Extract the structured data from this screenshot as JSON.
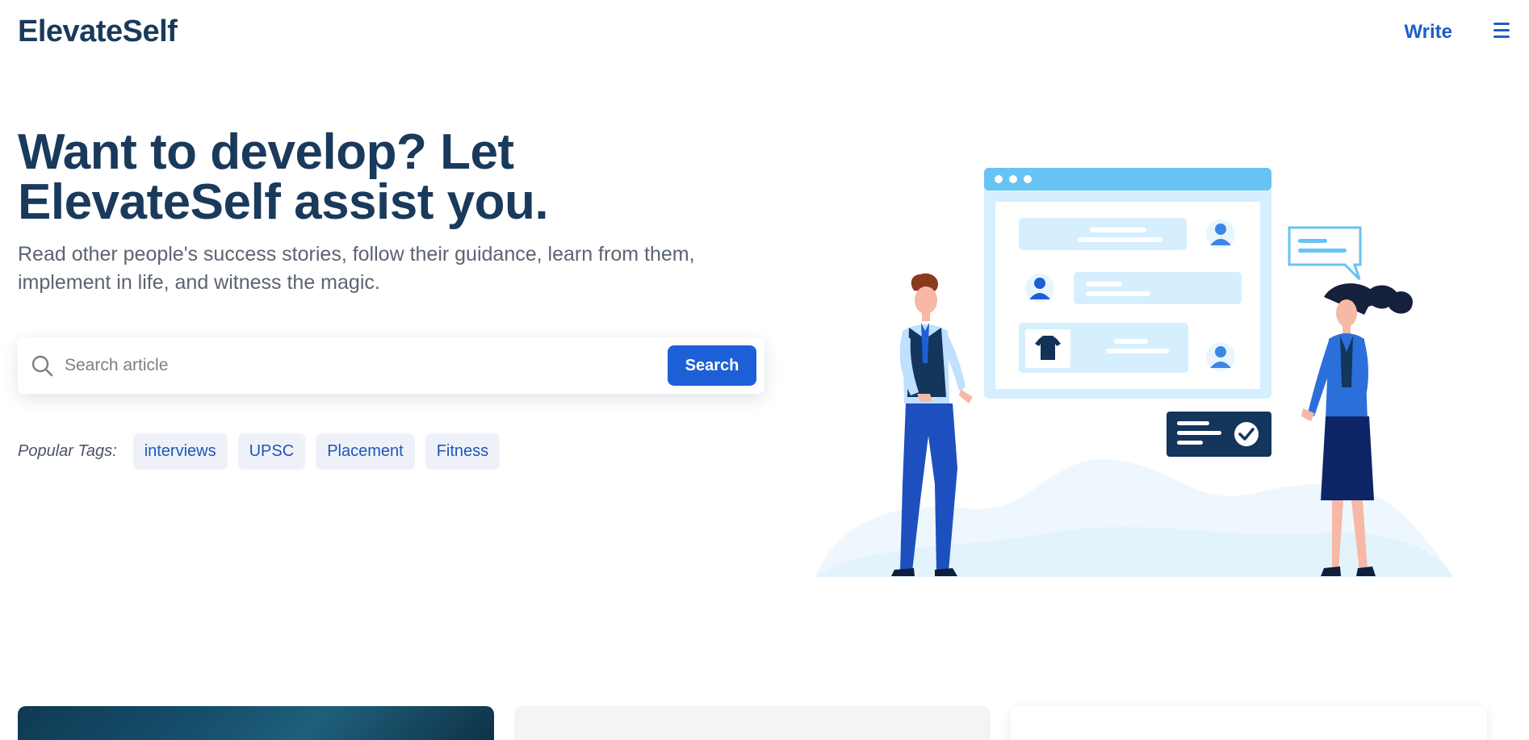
{
  "nav": {
    "logo": "ElevateSelf",
    "write_label": "Write",
    "menu_icon": "hamburger-icon"
  },
  "hero": {
    "title": "Want to develop? Let ElevateSelf assist you.",
    "subtitle": "Read other people's success stories, follow their guidance, learn from them, implement in life, and witness the magic."
  },
  "search": {
    "icon": "search-icon",
    "placeholder": "Search article",
    "value": "",
    "button_label": "Search"
  },
  "tags": {
    "label": "Popular Tags:",
    "items": [
      "interviews",
      "UPSC",
      "Placement",
      "Fitness"
    ]
  },
  "colors": {
    "brand": "#1a3a5c",
    "accent": "#1d5fd6",
    "tag_bg": "#eef2f8",
    "muted_text": "#5b6472"
  }
}
